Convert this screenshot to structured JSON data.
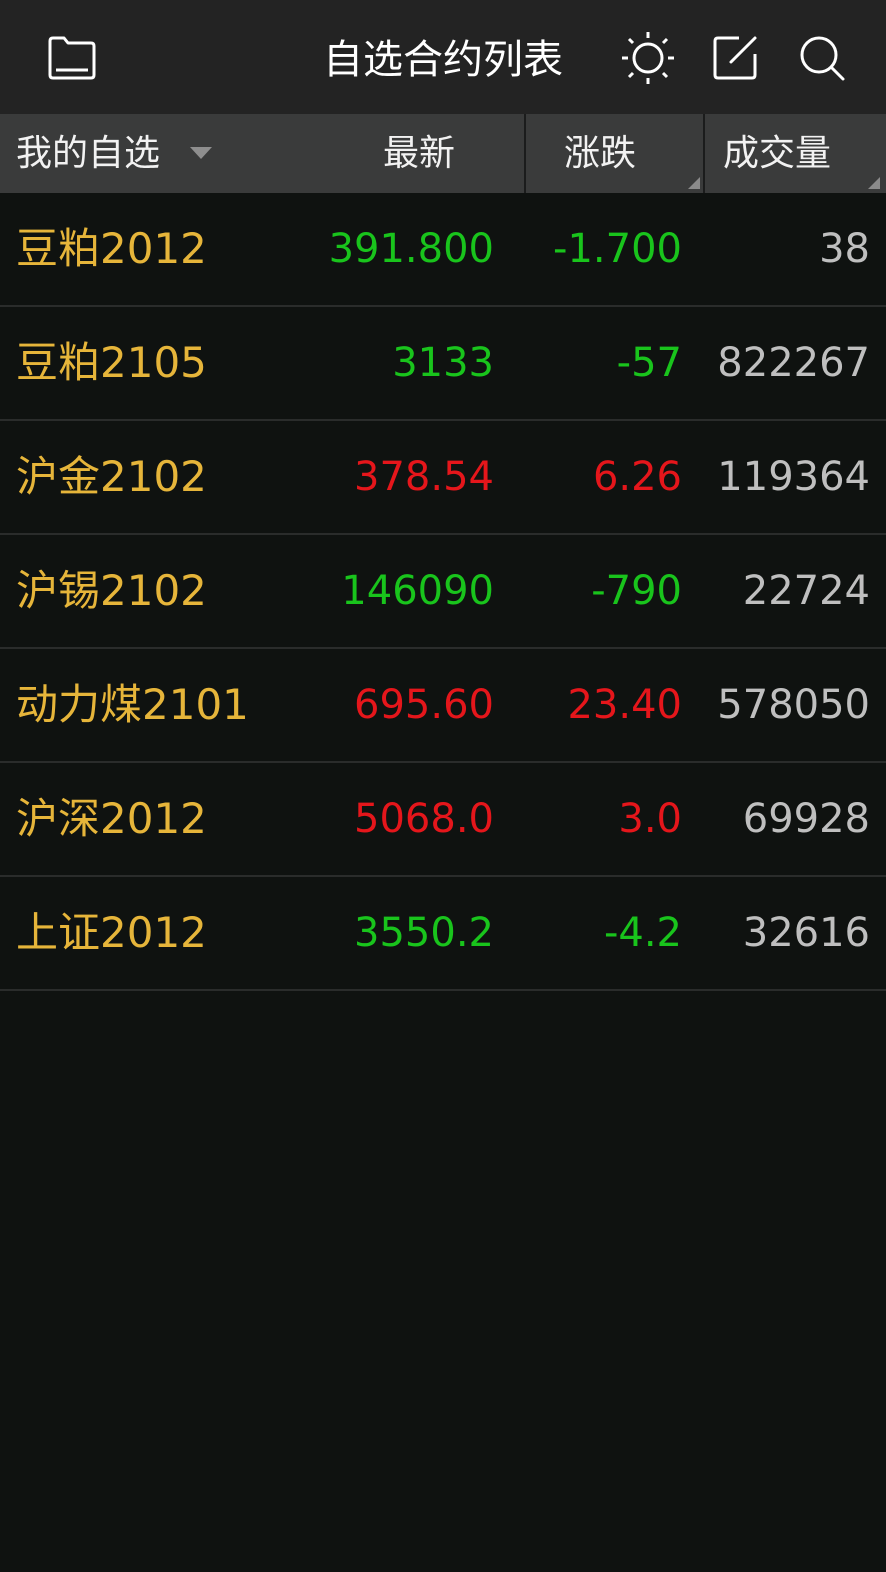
{
  "topbar": {
    "title": "自选合约列表",
    "icons": [
      "folder-icon",
      "brightness-icon",
      "edit-icon",
      "search-icon"
    ]
  },
  "header": {
    "group_label": "我的自选",
    "col_latest": "最新",
    "col_change": "涨跌",
    "col_volume": "成交量"
  },
  "colors": {
    "up": "#e5161b",
    "down": "#19c41c",
    "name": "#e6b53a",
    "volume": "#bfbfbf",
    "header_bg": "#3a3b3b",
    "topbar_bg": "#232323",
    "page_bg": "#0f1210"
  },
  "rows": [
    {
      "name": "豆粕2012",
      "latest": "391.800",
      "change": "-1.700",
      "volume": "38",
      "trend": "down"
    },
    {
      "name": "豆粕2105",
      "latest": "3133",
      "change": "-57",
      "volume": "822267",
      "trend": "down"
    },
    {
      "name": "沪金2102",
      "latest": "378.54",
      "change": "6.26",
      "volume": "119364",
      "trend": "up"
    },
    {
      "name": "沪锡2102",
      "latest": "146090",
      "change": "-790",
      "volume": "22724",
      "trend": "down"
    },
    {
      "name": "动力煤2101",
      "latest": "695.60",
      "change": "23.40",
      "volume": "578050",
      "trend": "up"
    },
    {
      "name": "沪深2012",
      "latest": "5068.0",
      "change": "3.0",
      "volume": "69928",
      "trend": "up"
    },
    {
      "name": "上证2012",
      "latest": "3550.2",
      "change": "-4.2",
      "volume": "32616",
      "trend": "down"
    }
  ]
}
